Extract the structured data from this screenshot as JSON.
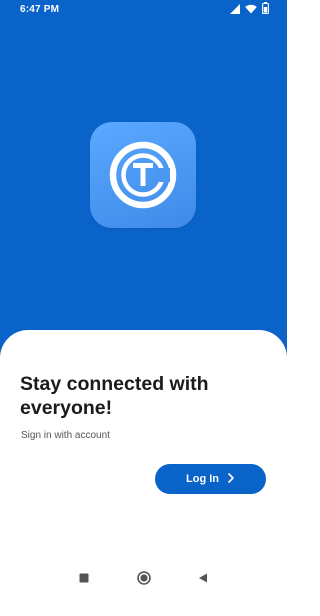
{
  "status_bar": {
    "time": "6:47 PM",
    "icons": [
      "signal-icon",
      "wifi-icon",
      "battery-icon"
    ]
  },
  "app": {
    "logo_icon": "tc-circle-logo-icon",
    "colors": {
      "brand_blue": "#0a63c9",
      "logo_light_blue": "#5aa8ff",
      "text_dark": "#1b1b1b",
      "text_muted": "#555555",
      "sheet_background": "#ffffff"
    }
  },
  "onboarding": {
    "headline": "Stay connected with everyone!",
    "subtitle": "Sign in with account",
    "login_label": "Log In"
  },
  "nav_bar": {
    "icons": [
      "recent-apps-icon",
      "home-icon",
      "back-icon"
    ]
  }
}
